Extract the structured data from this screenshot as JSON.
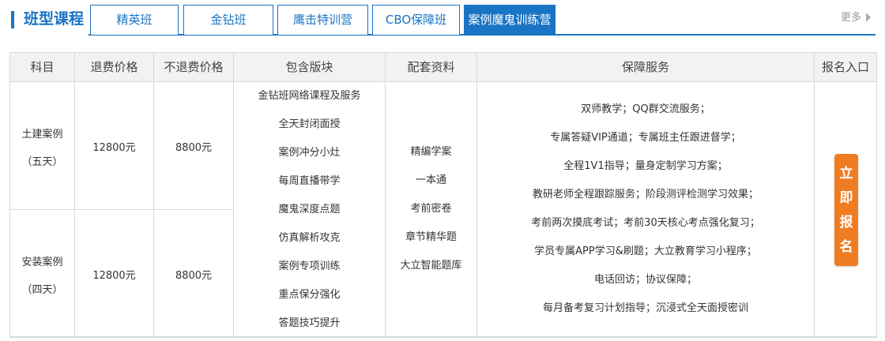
{
  "header": {
    "title": "班型课程",
    "tabs": [
      {
        "label": "精英班",
        "active": false
      },
      {
        "label": "金钻班",
        "active": false
      },
      {
        "label": "鹰击特训营",
        "active": false
      },
      {
        "label": "CBO保障班",
        "active": false
      },
      {
        "label": "案例魔鬼训练营",
        "active": true
      }
    ],
    "more_label": "更多"
  },
  "table": {
    "headers": [
      "科目",
      "退费价格",
      "不退费价格",
      "包含版块",
      "配套资料",
      "保障服务",
      "报名入口"
    ],
    "rows": [
      {
        "subject": "土建案例",
        "duration": "（五天）",
        "refund_price": "12800元",
        "norefund_price": "8800元"
      },
      {
        "subject": "安装案例",
        "duration": "（四天）",
        "refund_price": "12800元",
        "norefund_price": "8800元"
      }
    ],
    "modules": [
      "金钻班网络课程及服务",
      "全天封闭面授",
      "案例冲分小灶",
      "每周直播带学",
      "魔鬼深度点题",
      "仿真解析攻克",
      "案例专项训练",
      "重点保分强化",
      "答题技巧提升"
    ],
    "materials": [
      "精编学案",
      "一本通",
      "考前密卷",
      "章节精华题",
      "大立智能题库"
    ],
    "services": [
      "双师教学；QQ群交流服务；",
      "专属答疑VIP通道；专属班主任跟进督学；",
      "全程1V1指导；量身定制学习方案；",
      "教研老师全程跟踪服务；阶段测评检测学习效果；",
      "考前两次摸底考试；考前30天核心考点强化复习；",
      "学员专属APP学习&刷题；大立教育学习小程序；",
      "电话回访；协议保障；",
      "每月备考复习计划指导；沉浸式全天面授密训"
    ],
    "signup_chars": [
      "立",
      "即",
      "报",
      "名"
    ]
  },
  "colors": {
    "accent": "#1a74c4",
    "signup": "#f07c22",
    "header_bg": "#f2f2f2",
    "border": "#d9d9d9"
  }
}
